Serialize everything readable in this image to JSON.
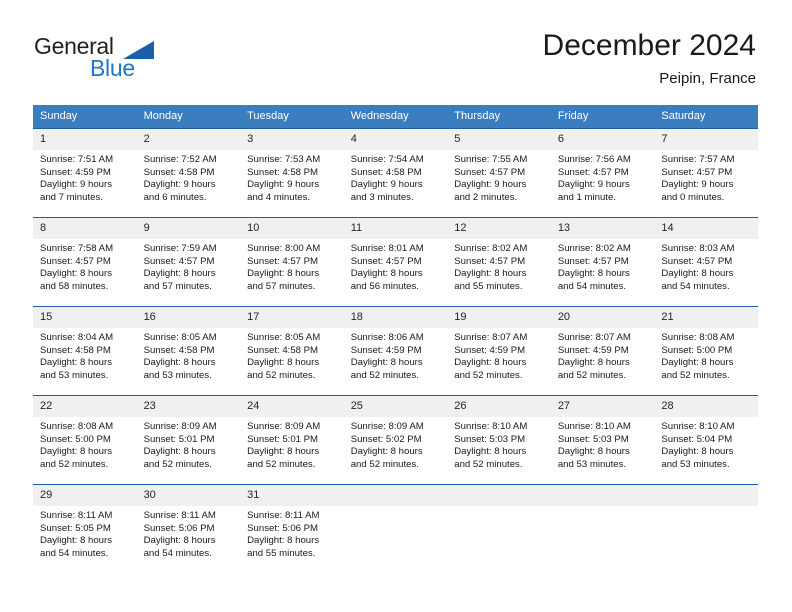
{
  "brand": {
    "name_part1": "General",
    "name_part2": "Blue",
    "logo_icon": "blue-triangle-flag-icon",
    "accent_color": "#2176c7",
    "dark_color": "#231f20"
  },
  "header": {
    "month_title": "December 2024",
    "location": "Peipin, France"
  },
  "calendar": {
    "header_bg": "#3b7ebf",
    "row_border_color": "#1a5fa8",
    "daynum_bg": "#f0f0f0",
    "weekday_labels": [
      "Sunday",
      "Monday",
      "Tuesday",
      "Wednesday",
      "Thursday",
      "Friday",
      "Saturday"
    ],
    "weeks": [
      [
        {
          "day": "1",
          "sunrise": "Sunrise: 7:51 AM",
          "sunset": "Sunset: 4:59 PM",
          "daylight_line1": "Daylight: 9 hours",
          "daylight_line2": "and 7 minutes."
        },
        {
          "day": "2",
          "sunrise": "Sunrise: 7:52 AM",
          "sunset": "Sunset: 4:58 PM",
          "daylight_line1": "Daylight: 9 hours",
          "daylight_line2": "and 6 minutes."
        },
        {
          "day": "3",
          "sunrise": "Sunrise: 7:53 AM",
          "sunset": "Sunset: 4:58 PM",
          "daylight_line1": "Daylight: 9 hours",
          "daylight_line2": "and 4 minutes."
        },
        {
          "day": "4",
          "sunrise": "Sunrise: 7:54 AM",
          "sunset": "Sunset: 4:58 PM",
          "daylight_line1": "Daylight: 9 hours",
          "daylight_line2": "and 3 minutes."
        },
        {
          "day": "5",
          "sunrise": "Sunrise: 7:55 AM",
          "sunset": "Sunset: 4:57 PM",
          "daylight_line1": "Daylight: 9 hours",
          "daylight_line2": "and 2 minutes."
        },
        {
          "day": "6",
          "sunrise": "Sunrise: 7:56 AM",
          "sunset": "Sunset: 4:57 PM",
          "daylight_line1": "Daylight: 9 hours",
          "daylight_line2": "and 1 minute."
        },
        {
          "day": "7",
          "sunrise": "Sunrise: 7:57 AM",
          "sunset": "Sunset: 4:57 PM",
          "daylight_line1": "Daylight: 9 hours",
          "daylight_line2": "and 0 minutes."
        }
      ],
      [
        {
          "day": "8",
          "sunrise": "Sunrise: 7:58 AM",
          "sunset": "Sunset: 4:57 PM",
          "daylight_line1": "Daylight: 8 hours",
          "daylight_line2": "and 58 minutes."
        },
        {
          "day": "9",
          "sunrise": "Sunrise: 7:59 AM",
          "sunset": "Sunset: 4:57 PM",
          "daylight_line1": "Daylight: 8 hours",
          "daylight_line2": "and 57 minutes."
        },
        {
          "day": "10",
          "sunrise": "Sunrise: 8:00 AM",
          "sunset": "Sunset: 4:57 PM",
          "daylight_line1": "Daylight: 8 hours",
          "daylight_line2": "and 57 minutes."
        },
        {
          "day": "11",
          "sunrise": "Sunrise: 8:01 AM",
          "sunset": "Sunset: 4:57 PM",
          "daylight_line1": "Daylight: 8 hours",
          "daylight_line2": "and 56 minutes."
        },
        {
          "day": "12",
          "sunrise": "Sunrise: 8:02 AM",
          "sunset": "Sunset: 4:57 PM",
          "daylight_line1": "Daylight: 8 hours",
          "daylight_line2": "and 55 minutes."
        },
        {
          "day": "13",
          "sunrise": "Sunrise: 8:02 AM",
          "sunset": "Sunset: 4:57 PM",
          "daylight_line1": "Daylight: 8 hours",
          "daylight_line2": "and 54 minutes."
        },
        {
          "day": "14",
          "sunrise": "Sunrise: 8:03 AM",
          "sunset": "Sunset: 4:57 PM",
          "daylight_line1": "Daylight: 8 hours",
          "daylight_line2": "and 54 minutes."
        }
      ],
      [
        {
          "day": "15",
          "sunrise": "Sunrise: 8:04 AM",
          "sunset": "Sunset: 4:58 PM",
          "daylight_line1": "Daylight: 8 hours",
          "daylight_line2": "and 53 minutes."
        },
        {
          "day": "16",
          "sunrise": "Sunrise: 8:05 AM",
          "sunset": "Sunset: 4:58 PM",
          "daylight_line1": "Daylight: 8 hours",
          "daylight_line2": "and 53 minutes."
        },
        {
          "day": "17",
          "sunrise": "Sunrise: 8:05 AM",
          "sunset": "Sunset: 4:58 PM",
          "daylight_line1": "Daylight: 8 hours",
          "daylight_line2": "and 52 minutes."
        },
        {
          "day": "18",
          "sunrise": "Sunrise: 8:06 AM",
          "sunset": "Sunset: 4:59 PM",
          "daylight_line1": "Daylight: 8 hours",
          "daylight_line2": "and 52 minutes."
        },
        {
          "day": "19",
          "sunrise": "Sunrise: 8:07 AM",
          "sunset": "Sunset: 4:59 PM",
          "daylight_line1": "Daylight: 8 hours",
          "daylight_line2": "and 52 minutes."
        },
        {
          "day": "20",
          "sunrise": "Sunrise: 8:07 AM",
          "sunset": "Sunset: 4:59 PM",
          "daylight_line1": "Daylight: 8 hours",
          "daylight_line2": "and 52 minutes."
        },
        {
          "day": "21",
          "sunrise": "Sunrise: 8:08 AM",
          "sunset": "Sunset: 5:00 PM",
          "daylight_line1": "Daylight: 8 hours",
          "daylight_line2": "and 52 minutes."
        }
      ],
      [
        {
          "day": "22",
          "sunrise": "Sunrise: 8:08 AM",
          "sunset": "Sunset: 5:00 PM",
          "daylight_line1": "Daylight: 8 hours",
          "daylight_line2": "and 52 minutes."
        },
        {
          "day": "23",
          "sunrise": "Sunrise: 8:09 AM",
          "sunset": "Sunset: 5:01 PM",
          "daylight_line1": "Daylight: 8 hours",
          "daylight_line2": "and 52 minutes."
        },
        {
          "day": "24",
          "sunrise": "Sunrise: 8:09 AM",
          "sunset": "Sunset: 5:01 PM",
          "daylight_line1": "Daylight: 8 hours",
          "daylight_line2": "and 52 minutes."
        },
        {
          "day": "25",
          "sunrise": "Sunrise: 8:09 AM",
          "sunset": "Sunset: 5:02 PM",
          "daylight_line1": "Daylight: 8 hours",
          "daylight_line2": "and 52 minutes."
        },
        {
          "day": "26",
          "sunrise": "Sunrise: 8:10 AM",
          "sunset": "Sunset: 5:03 PM",
          "daylight_line1": "Daylight: 8 hours",
          "daylight_line2": "and 52 minutes."
        },
        {
          "day": "27",
          "sunrise": "Sunrise: 8:10 AM",
          "sunset": "Sunset: 5:03 PM",
          "daylight_line1": "Daylight: 8 hours",
          "daylight_line2": "and 53 minutes."
        },
        {
          "day": "28",
          "sunrise": "Sunrise: 8:10 AM",
          "sunset": "Sunset: 5:04 PM",
          "daylight_line1": "Daylight: 8 hours",
          "daylight_line2": "and 53 minutes."
        }
      ],
      [
        {
          "day": "29",
          "sunrise": "Sunrise: 8:11 AM",
          "sunset": "Sunset: 5:05 PM",
          "daylight_line1": "Daylight: 8 hours",
          "daylight_line2": "and 54 minutes."
        },
        {
          "day": "30",
          "sunrise": "Sunrise: 8:11 AM",
          "sunset": "Sunset: 5:06 PM",
          "daylight_line1": "Daylight: 8 hours",
          "daylight_line2": "and 54 minutes."
        },
        {
          "day": "31",
          "sunrise": "Sunrise: 8:11 AM",
          "sunset": "Sunset: 5:06 PM",
          "daylight_line1": "Daylight: 8 hours",
          "daylight_line2": "and 55 minutes."
        },
        {
          "day": "",
          "sunrise": "",
          "sunset": "",
          "daylight_line1": "",
          "daylight_line2": ""
        },
        {
          "day": "",
          "sunrise": "",
          "sunset": "",
          "daylight_line1": "",
          "daylight_line2": ""
        },
        {
          "day": "",
          "sunrise": "",
          "sunset": "",
          "daylight_line1": "",
          "daylight_line2": ""
        },
        {
          "day": "",
          "sunrise": "",
          "sunset": "",
          "daylight_line1": "",
          "daylight_line2": ""
        }
      ]
    ]
  }
}
